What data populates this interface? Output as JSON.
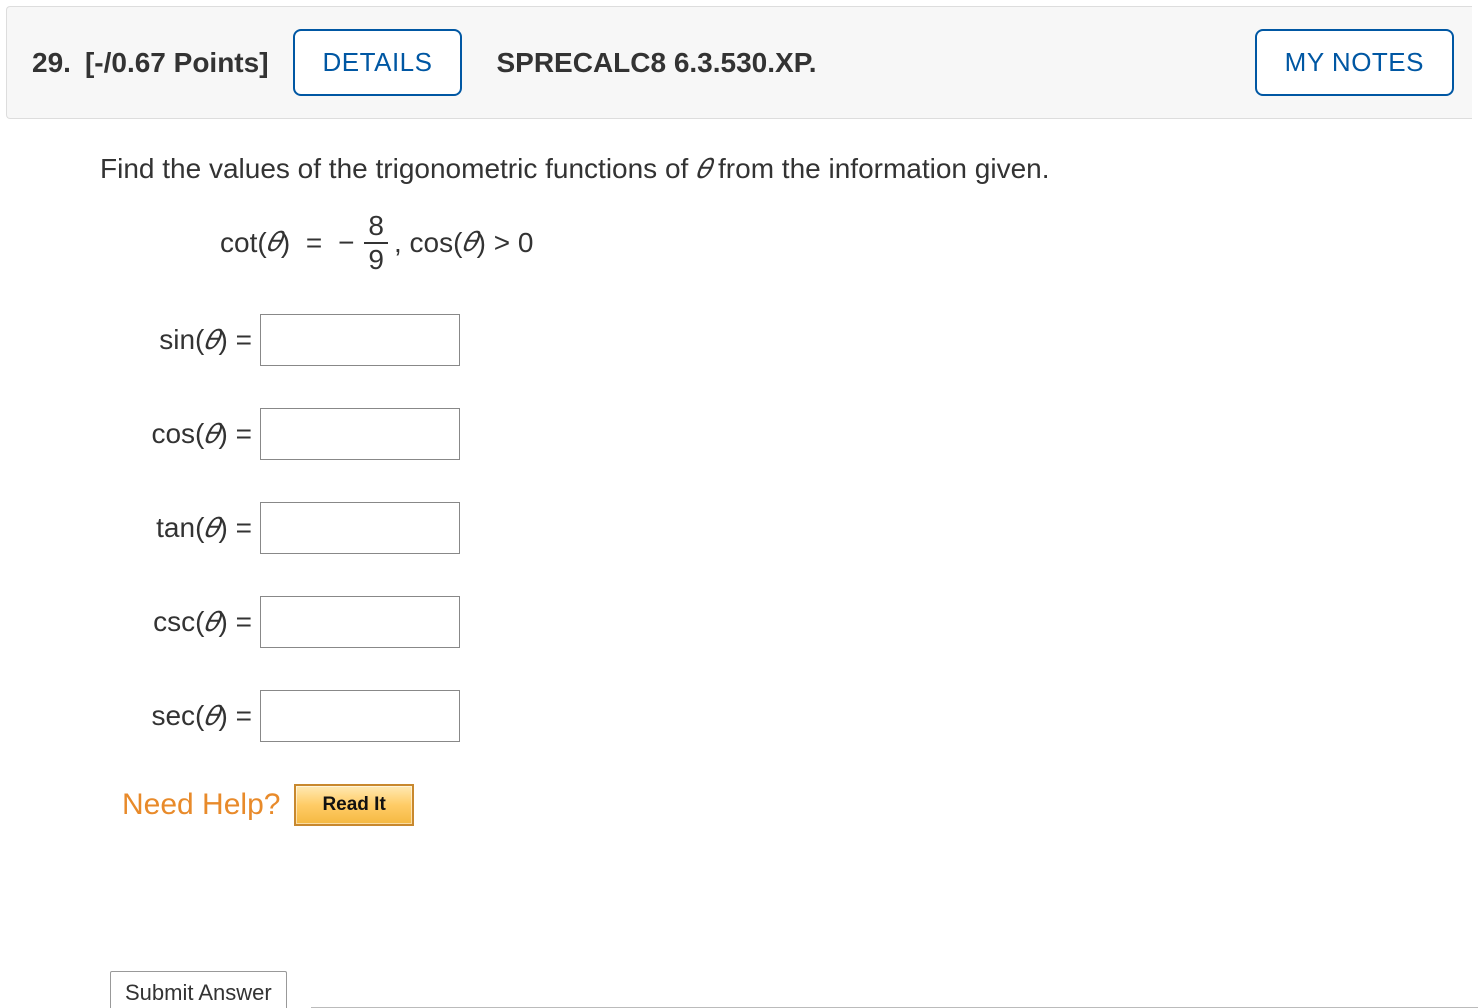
{
  "header": {
    "number": "29.",
    "points": "[-/0.67 Points]",
    "details_label": "DETAILS",
    "assignment": "SPRECALC8 6.3.530.XP.",
    "mynotes_label": "MY NOTES"
  },
  "question": {
    "prompt_pre": "Find the values of the trigonometric functions of ",
    "theta": "𝜃",
    "prompt_post": " from the information given.",
    "given": {
      "func": "cot(",
      "eq": ") = −",
      "num": "8",
      "den": "9",
      "sep": ", cos(",
      "cond": ") > 0"
    },
    "answers": [
      {
        "label_pre": "sin(",
        "label_post": ") ="
      },
      {
        "label_pre": "cos(",
        "label_post": ") ="
      },
      {
        "label_pre": "tan(",
        "label_post": ") ="
      },
      {
        "label_pre": "csc(",
        "label_post": ") ="
      },
      {
        "label_pre": "sec(",
        "label_post": ") ="
      }
    ]
  },
  "help": {
    "need_help": "Need Help?",
    "read_it": "Read It"
  },
  "submit": {
    "label": "Submit Answer"
  }
}
